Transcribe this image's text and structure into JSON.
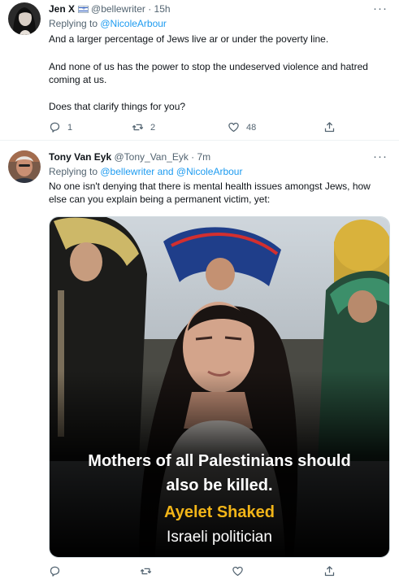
{
  "tweet1": {
    "name": "Jen X",
    "handle_time": "@bellewriter · 15h",
    "replying_prefix": "Replying to ",
    "replying_to": "@NicoleArbour",
    "lines": [
      "And a larger percentage of Jews live ar or under the poverty line.",
      "And none of us has the power to stop the undeserved violence and hatred coming at us.",
      "Does that clarify things for you?"
    ],
    "replies": "1",
    "retweets": "2",
    "likes": "48"
  },
  "tweet2": {
    "name": "Tony Van Eyk",
    "handle_time": "@Tony_Van_Eyk · 7m",
    "replying_prefix": "Replying to ",
    "replying_to": "@bellewriter and @NicoleArbour",
    "text": "No one isn't denying that there is mental health issues amongst Jews, how else can you explain being a permanent victim, yet:",
    "media": {
      "quote_line1": "Mothers of all Palestinians should",
      "quote_line2": "also be killed.",
      "person_name": "Ayelet Shaked",
      "person_title": "Israeli politician"
    }
  },
  "icons": {
    "reply": "reply-icon",
    "retweet": "retweet-icon",
    "like": "heart-icon",
    "share": "share-icon",
    "more": "more-icon"
  },
  "colors": {
    "link": "#1d9bf0",
    "secondary_text": "#536471",
    "caption_accent": "#f2b518"
  }
}
